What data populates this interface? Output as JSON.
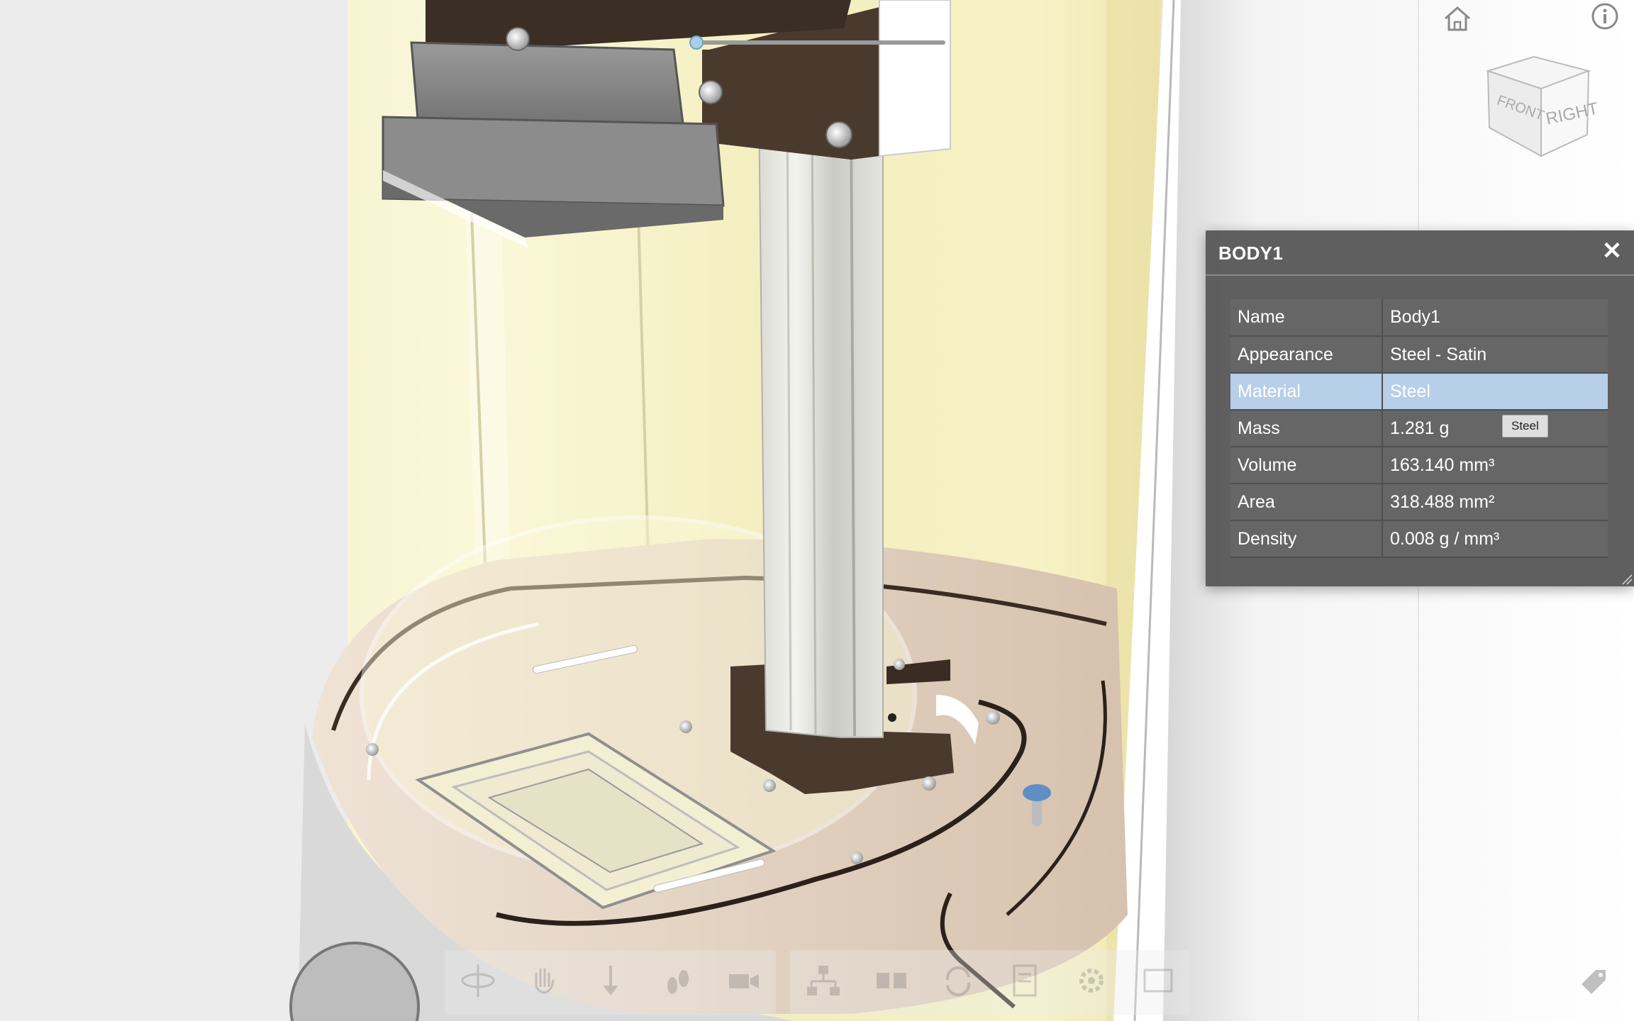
{
  "panel": {
    "title": "BODY1",
    "close_icon": "close-icon",
    "rows": [
      {
        "key": "Name",
        "value": "Body1"
      },
      {
        "key": "Appearance",
        "value": "Steel - Satin"
      },
      {
        "key": "Material",
        "value": "Steel",
        "selected": true
      },
      {
        "key": "Mass",
        "value": "1.281 g"
      },
      {
        "key": "Volume",
        "value": "163.140 mm³"
      },
      {
        "key": "Area",
        "value": "318.488 mm²"
      },
      {
        "key": "Density",
        "value": "0.008 g / mm³"
      }
    ],
    "tooltip": "Steel",
    "selected_row_color": "#b7cfe8"
  },
  "viewcube": {
    "front_label": "FRONT",
    "right_label": "RIGHT"
  },
  "nav": {
    "home_icon": "home-icon",
    "info_icon": "info-icon"
  },
  "toolbar": {
    "left_group": [
      "orbit-icon",
      "pan-icon",
      "zoom-icon",
      "walk-icon",
      "camera-icon"
    ],
    "right_group": [
      "model-browser-icon",
      "explode-icon",
      "section-icon",
      "properties-icon",
      "settings-icon",
      "fullscreen-icon"
    ]
  },
  "colors": {
    "background": "#ececec",
    "panel_bg": "#585858",
    "bracket_brown": "#4a3a2e",
    "glass_yellow": "#f7f3c8"
  }
}
